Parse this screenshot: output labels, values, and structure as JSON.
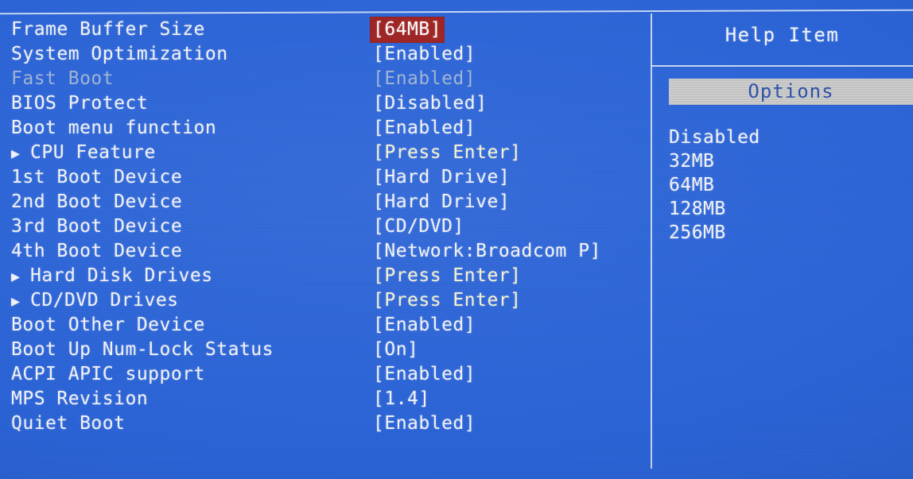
{
  "screen": {
    "background_color": "#2a63d8",
    "text_color": "#f2f4f8",
    "dim_color": "#9fb4d6",
    "highlight_color": "#9e2020",
    "accent_color": "#f6f3d2",
    "options_bar_color": "#c9c9c9",
    "options_bar_text_color": "#2b4fa8"
  },
  "settings": {
    "rows": [
      {
        "label": "Frame Buffer Size",
        "value": "[64MB]",
        "submenu": false,
        "state": "selected"
      },
      {
        "label": "System Optimization",
        "value": "[Enabled]",
        "submenu": false,
        "state": "normal"
      },
      {
        "label": "Fast Boot",
        "value": "[Enabled]",
        "submenu": false,
        "state": "disabled"
      },
      {
        "label": "BIOS Protect",
        "value": "[Disabled]",
        "submenu": false,
        "state": "normal"
      },
      {
        "label": "Boot menu function",
        "value": "[Enabled]",
        "submenu": false,
        "state": "normal"
      },
      {
        "label": "CPU Feature",
        "value": "[Press Enter]",
        "submenu": true,
        "state": "accent"
      },
      {
        "label": "1st Boot Device",
        "value": "[Hard Drive]",
        "submenu": false,
        "state": "normal"
      },
      {
        "label": "2nd Boot Device",
        "value": "[Hard Drive]",
        "submenu": false,
        "state": "normal"
      },
      {
        "label": "3rd Boot Device",
        "value": "[CD/DVD]",
        "submenu": false,
        "state": "normal"
      },
      {
        "label": "4th Boot Device",
        "value": "[Network:Broadcom P]",
        "submenu": false,
        "state": "normal"
      },
      {
        "label": "Hard Disk Drives",
        "value": "[Press Enter]",
        "submenu": true,
        "state": "accent"
      },
      {
        "label": "CD/DVD Drives",
        "value": "[Press Enter]",
        "submenu": true,
        "state": "accent"
      },
      {
        "label": "Boot Other Device",
        "value": "[Enabled]",
        "submenu": false,
        "state": "normal"
      },
      {
        "label": "Boot Up Num-Lock Status",
        "value": "[On]",
        "submenu": false,
        "state": "normal"
      },
      {
        "label": "ACPI APIC support",
        "value": "[Enabled]",
        "submenu": false,
        "state": "normal"
      },
      {
        "label": "MPS Revision",
        "value": "[1.4]",
        "submenu": false,
        "state": "normal"
      },
      {
        "label": "Quiet Boot",
        "value": "[Enabled]",
        "submenu": false,
        "state": "normal"
      }
    ],
    "submenu_marker": "▶"
  },
  "help_panel": {
    "title": "Help Item",
    "options_heading": "Options",
    "options": [
      "Disabled",
      "32MB",
      "64MB",
      "128MB",
      "256MB"
    ]
  }
}
